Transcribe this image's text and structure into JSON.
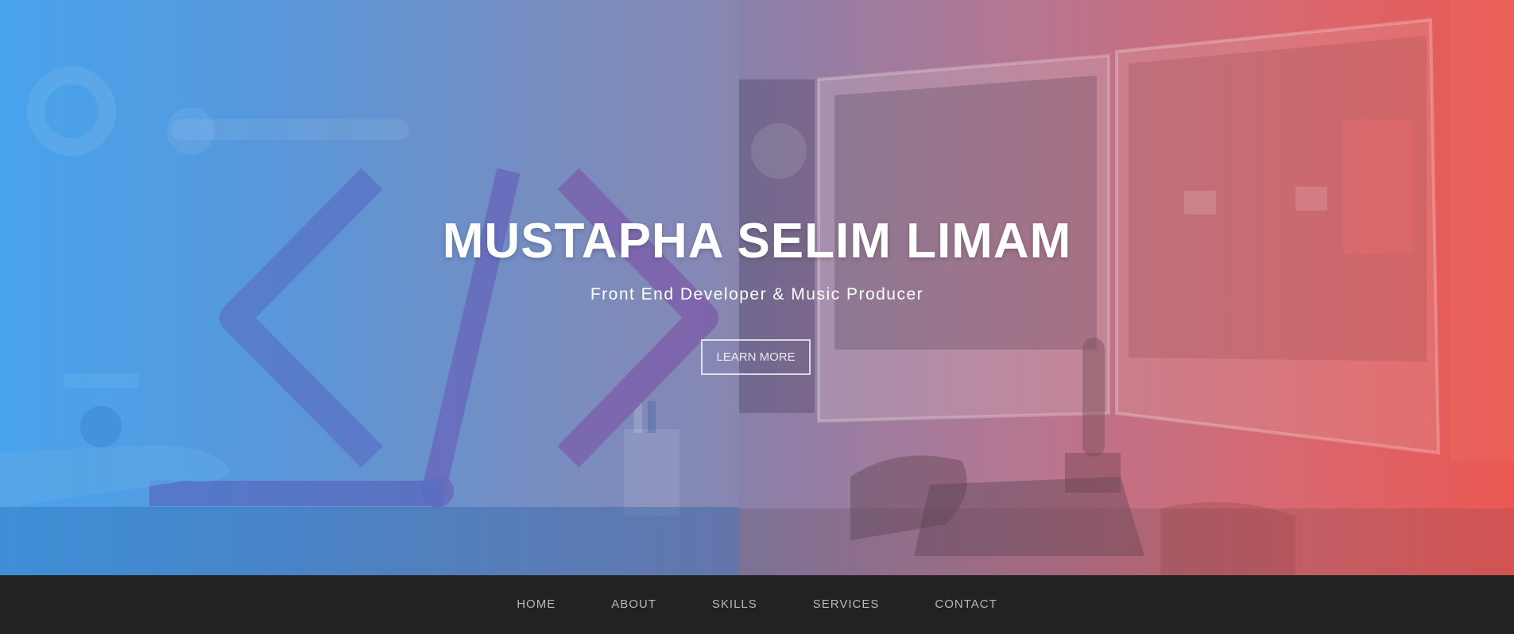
{
  "hero": {
    "title": "MUSTAPHA SELIM LIMAM",
    "subtitle": "Front End Developer & Music Producer",
    "cta_label": "LEARN MORE",
    "colors": {
      "left_gradient": "#45a3f0",
      "right_gradient": "#f05550",
      "title": "#ffffff"
    }
  },
  "nav": {
    "items": [
      {
        "label": "HOME"
      },
      {
        "label": "ABOUT"
      },
      {
        "label": "SKILLS"
      },
      {
        "label": "SERVICES"
      },
      {
        "label": "CONTACT"
      }
    ],
    "background": "#222222",
    "text_color": "#b8b8b8"
  },
  "illustrations": {
    "left": "code-brackets-illustration",
    "right": "music-studio-monitors-photo"
  }
}
